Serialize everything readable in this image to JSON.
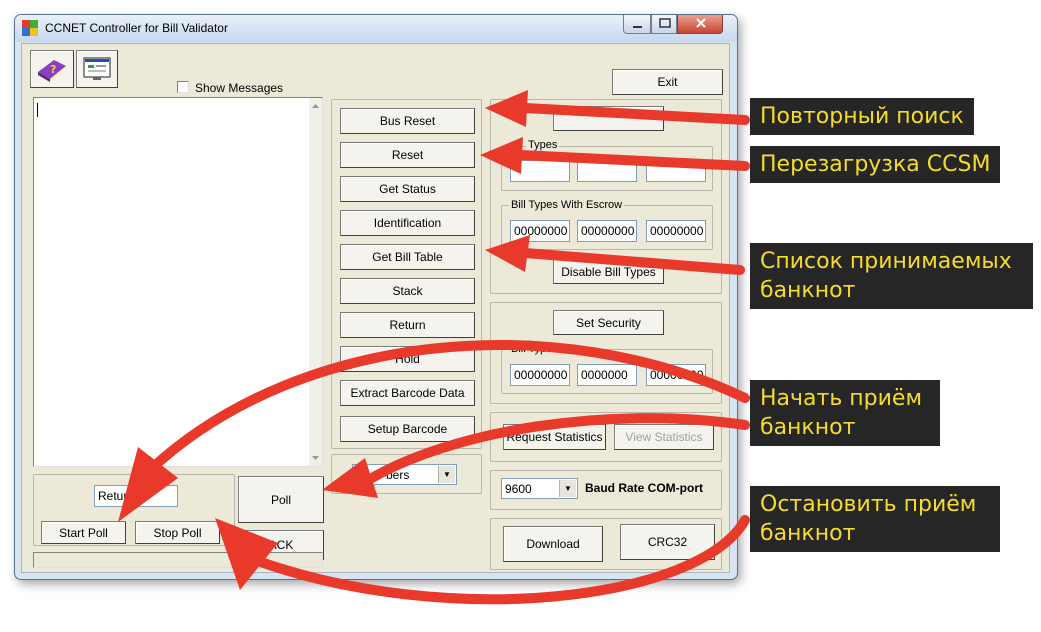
{
  "window": {
    "title": "CCNET Controller for Bill Validator"
  },
  "toolbar": {
    "help_icon": "help-book-icon",
    "monitor_icon": "monitor-icon",
    "show_messages_label": "Show Messages",
    "show_messages_checked": false,
    "exit_label": "Exit"
  },
  "commands": {
    "bus_reset": "Bus Reset",
    "reset": "Reset",
    "get_status": "Get Status",
    "identification": "Identification",
    "get_bill_table": "Get Bill Table",
    "stack": "Stack",
    "return": "Return",
    "hold": "Hold",
    "extract_barcode": "Extract Barcode Data",
    "setup_barcode": "Setup Barcode",
    "combo_value": "bers"
  },
  "poll": {
    "return_field": "Return",
    "start_poll": "Start Poll",
    "stop_poll": "Stop Poll",
    "poll": "Poll",
    "ack": "ACK"
  },
  "bill_types": {
    "label": "Types",
    "escrow_label": "Bill Types With Escrow",
    "escrow_values": [
      "00000000",
      "00000000",
      "00000000"
    ],
    "disable_button": "Disable Bill Types"
  },
  "security": {
    "button": "Set Security",
    "label": "Bill Types",
    "values": [
      "00000000",
      "0000000",
      "00000000"
    ]
  },
  "statistics": {
    "request": "Request Statistics",
    "view": "View Statistics"
  },
  "port": {
    "baud_value": "9600",
    "baud_label": "Baud Rate COM-port",
    "download": "Download",
    "crc32": "CRC32"
  },
  "annotations": [
    "Повторный поиск",
    "Перезагрузка CCSM",
    "Список принимаемых банкнот",
    "Начать приём банкнот",
    "Остановить приём банкнот"
  ],
  "colors": {
    "arrow": "#e8392b",
    "annotation_bg": "#262626",
    "annotation_text": "#f6dc2a",
    "window_frame": "#d7e4f2",
    "client_bg": "#ece9d8"
  }
}
